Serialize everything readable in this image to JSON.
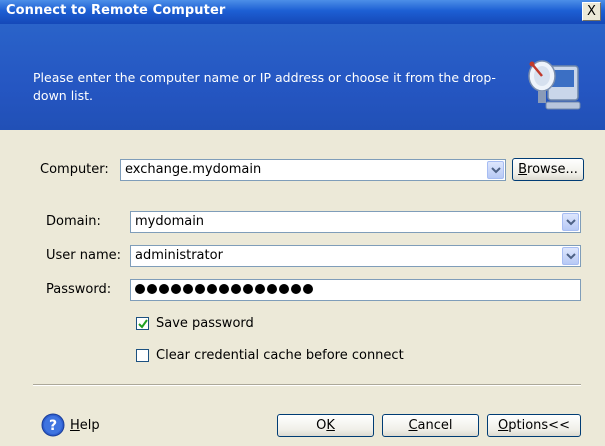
{
  "window": {
    "title": "Connect to Remote Computer",
    "close_glyph": "X"
  },
  "banner": {
    "instructions": "Please enter the computer name or IP address or choose it from the drop-down list.",
    "icon": "remote-computer-satellite-icon"
  },
  "form": {
    "computer": {
      "label": "Computer:",
      "value": "exchange.mydomain"
    },
    "browse_label_prefix": "",
    "browse_label_u": "B",
    "browse_label_rest": "rowse...",
    "domain": {
      "label": "Domain:",
      "value": "mydomain"
    },
    "username": {
      "label": "User name:",
      "value": "administrator"
    },
    "password": {
      "label": "Password:",
      "masked_length": 15
    },
    "save_password": {
      "label": "Save password",
      "checked": true
    },
    "clear_cache": {
      "label": "Clear credential cache before connect",
      "checked": false
    }
  },
  "footer": {
    "help_u": "H",
    "help_rest": "elp",
    "ok_prefix": "O",
    "ok_u": "K",
    "cancel_u": "C",
    "cancel_rest": "ancel",
    "options_u": "O",
    "options_rest": "ptions<<"
  },
  "colors": {
    "titlebar": "#1d5fd3",
    "banner": "#2556c2",
    "dialog_bg": "#ece9d8",
    "button_border": "#003c74"
  }
}
